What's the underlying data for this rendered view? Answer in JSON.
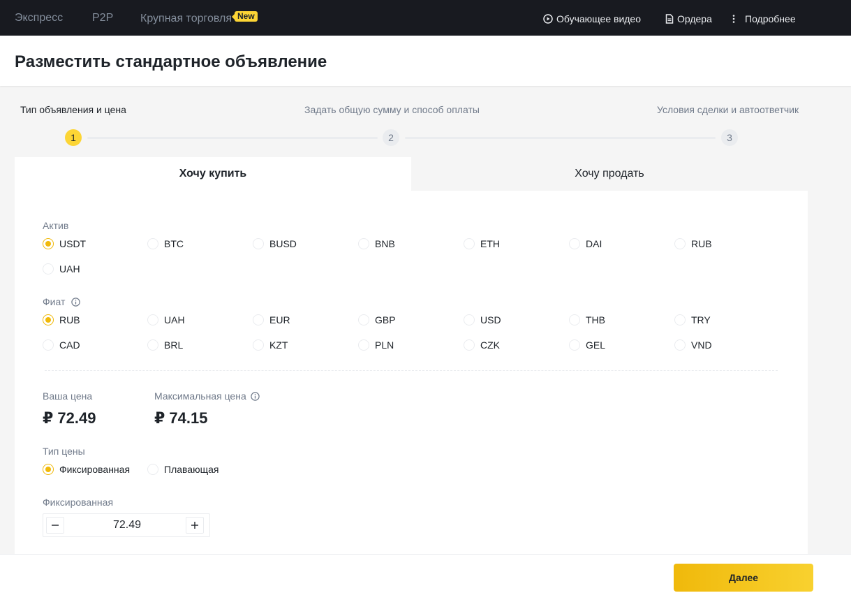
{
  "nav": {
    "express": "Экспресс",
    "p2p": "P2P",
    "block_trade": "Крупная торговля",
    "new_badge": "New",
    "video": "Обучающее видео",
    "orders": "Ордера",
    "more": "Подробнее"
  },
  "page": {
    "title": "Разместить стандартное объявление"
  },
  "steps": [
    {
      "num": "1",
      "label": "Тип объявления и цена"
    },
    {
      "num": "2",
      "label": "Задать общую сумму и способ оплаты"
    },
    {
      "num": "3",
      "label": "Условия сделки и автоответчик"
    }
  ],
  "tabs": {
    "buy": "Хочу купить",
    "sell": "Хочу продать"
  },
  "asset": {
    "label": "Актив",
    "options": [
      "USDT",
      "BTC",
      "BUSD",
      "BNB",
      "ETH",
      "DAI",
      "RUB",
      "UAH"
    ],
    "selected": "USDT"
  },
  "fiat": {
    "label": "Фиат",
    "options": [
      "RUB",
      "UAH",
      "EUR",
      "GBP",
      "USD",
      "THB",
      "TRY",
      "CAD",
      "BRL",
      "KZT",
      "PLN",
      "CZK",
      "GEL",
      "VND"
    ],
    "selected": "RUB"
  },
  "price": {
    "your_label": "Ваша цена",
    "your_value": "₽ 72.49",
    "max_label": "Максимальная цена",
    "max_value": "₽ 74.15"
  },
  "price_type": {
    "label": "Тип цены",
    "fixed": "Фиксированная",
    "floating": "Плавающая",
    "selected": "fixed"
  },
  "fixed_input": {
    "label": "Фиксированная",
    "value": "72.49"
  },
  "footer": {
    "next": "Далее"
  },
  "colors": {
    "accent": "#f0b90b",
    "nav_bg": "#181a20"
  }
}
